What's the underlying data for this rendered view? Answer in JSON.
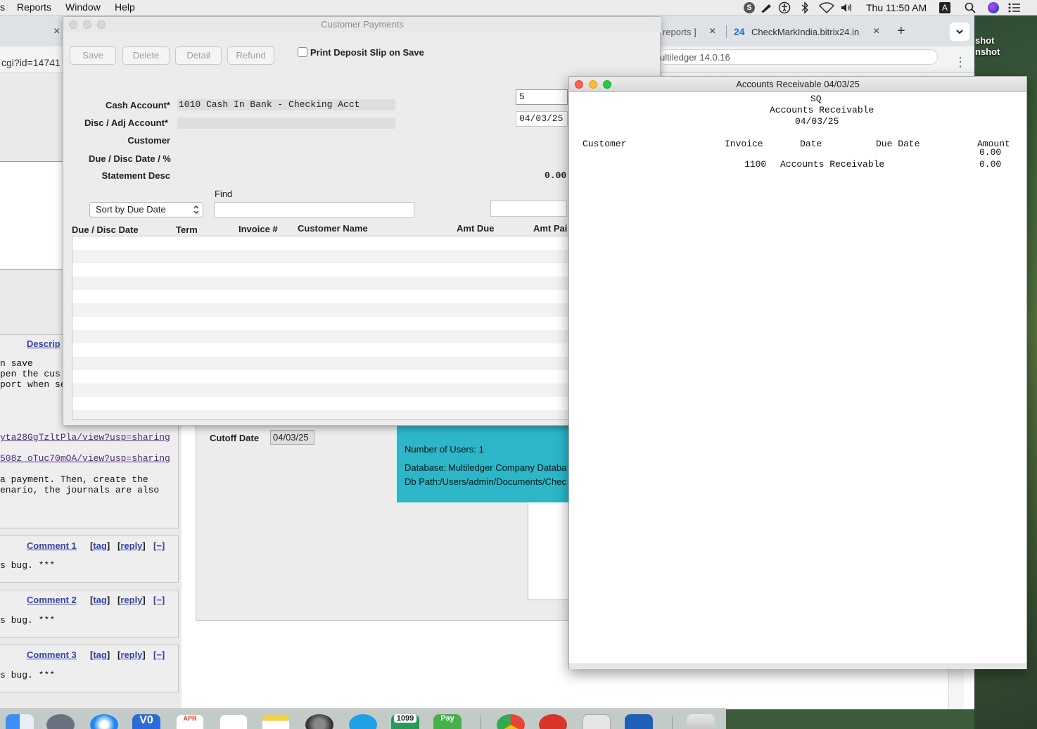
{
  "menubar": {
    "items": [
      "s",
      "Reports",
      "Window",
      "Help"
    ],
    "clock": "Thu 11:50 AM",
    "input_source": "A",
    "icons": [
      "skype-icon",
      "pen-icon",
      "accessibility-icon",
      "bluetooth-icon",
      "wifi-icon",
      "volume-icon",
      "input-source-icon",
      "spotlight-icon",
      "siri-icon",
      "notification-center-icon"
    ]
  },
  "browser": {
    "tab_close": "×",
    "tab_reports_text": "reports ]",
    "tab_bitrix_badge": "24",
    "tab_bitrix_title": "CheckMarkIndia.bitrix24.in",
    "new_tab": "+",
    "address_left": "cgi?id=14741",
    "address_right": "ultiledger 14.0.16",
    "menu_dots": "⋮",
    "desc_link": "Descrip",
    "desc_lines": [
      "n save",
      "pen the cus",
      "port when se"
    ],
    "link1": "yta28GgTzltPla/view?usp=sharing",
    "link2": "508z_oTuc70mOA/view?usp=sharing",
    "para_lines": [
      "a payment. Then, create the",
      "enario, the journals are also"
    ],
    "comments": [
      {
        "title": "Comment 1",
        "tag": "tag",
        "reply": "reply",
        "collapse": "[−]",
        "body": "s bug. ***"
      },
      {
        "title": "Comment 2",
        "tag": "tag",
        "reply": "reply",
        "collapse": "[−]",
        "body": "s bug. ***"
      },
      {
        "title": "Comment 3",
        "tag": "tag",
        "reply": "reply",
        "collapse": "[−]",
        "body": "s bug. ***"
      }
    ]
  },
  "wallpaper_labels": [
    "shot",
    "nshot"
  ],
  "multiledger_bg": {
    "cutoff_label": "Cutoff Date",
    "cutoff_value": "04/03/25",
    "users": "Number of Users: 1",
    "database_label": "Database:",
    "database_value": "Multiledger Company Databa",
    "dbpath_label": "Db Path:",
    "dbpath_value": "/Users/admin/Documents/Chec"
  },
  "customer_payments": {
    "title": "Customer Payments",
    "buttons": {
      "save": "Save",
      "delete": "Delete",
      "detail": "Detail",
      "refund": "Refund"
    },
    "print_deposit_label": "Print Deposit Slip on Save",
    "print_deposit_checked": false,
    "cash_account_label": "Cash Account*",
    "cash_account_value": "1010 Cash In Bank - Checking Acct",
    "disc_account_label": "Disc / Adj Account*",
    "disc_account_value": "",
    "customer_label": "Customer",
    "due_disc_label": "Due / Disc Date / %",
    "statement_label": "Statement Desc",
    "number_value": "5",
    "date_value": "04/03/25",
    "amount_value": "0.00",
    "find_label": "Find",
    "sort_value": "Sort by Due Date",
    "find_value": "",
    "columns": [
      "Due / Disc Date",
      "Term",
      "Invoice #",
      "Customer Name",
      "Amt Due",
      "Amt Pai"
    ],
    "rows": []
  },
  "ar_report": {
    "window_title": "Accounts Receivable 04/03/25",
    "company": "SQ",
    "report_title": "Accounts Receivable",
    "report_date": "04/03/25",
    "columns": [
      "Customer",
      "Invoice",
      "Date",
      "Due Date",
      "Amount"
    ],
    "total_top": "0.00",
    "lines": [
      {
        "invoice": "1100",
        "description": "Accounts Receivable",
        "amount": "0.00"
      }
    ]
  },
  "dock": {
    "calendar_month": "APR",
    "tax_form_label": "1099",
    "pay_label": "Pay"
  },
  "colors": {
    "teal": "#2cb6c8",
    "link": "#3344aa",
    "close": "#fe5f57",
    "minimize": "#febc2e",
    "zoom": "#28c840"
  }
}
